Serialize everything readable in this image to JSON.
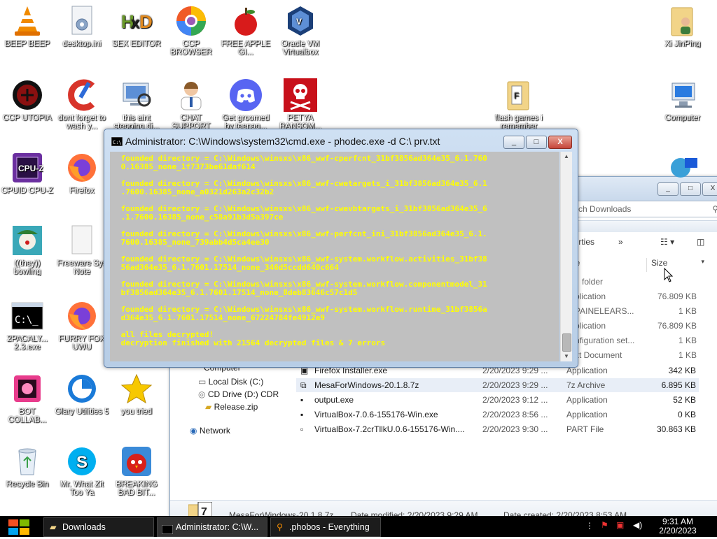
{
  "desktop": {
    "icons": [
      {
        "label": "BEEP BEEP",
        "icon": "vlc-cone-icon"
      },
      {
        "label": "desktop.ini",
        "icon": "settings-file-icon"
      },
      {
        "label": "SEX EDITOR",
        "icon": "hxd-editor-icon"
      },
      {
        "label": "CCP BROWSER",
        "icon": "browser-icon"
      },
      {
        "label": "FREE APPLE GI...",
        "icon": "apple-icon"
      },
      {
        "label": "Oracle VM Virtualbox",
        "icon": "virtualbox-icon"
      },
      {
        "label": "Xi JinPing",
        "icon": "user-folder-icon"
      },
      {
        "label": "CCP UTOPIA",
        "icon": "red-circle-icon"
      },
      {
        "label": "dont forget to wash y...",
        "icon": "ccleaner-icon"
      },
      {
        "label": "this aint stepping di...",
        "icon": "computer-scan-icon"
      },
      {
        "label": "CHAT SUPPORT",
        "icon": "support-person-icon"
      },
      {
        "label": "Get groomed by teenag...",
        "icon": "discord-icon"
      },
      {
        "label": "PETYA RANSOM...",
        "icon": "skull-icon"
      },
      {
        "label": "flash games i remember",
        "icon": "folder-icon"
      },
      {
        "label": "Computer",
        "icon": "computer-icon"
      },
      {
        "label": "CPUID CPU-Z",
        "icon": "cpuz-icon"
      },
      {
        "label": "Firefox",
        "icon": "firefox-icon"
      },
      {
        "label": "((they)) bowling",
        "icon": "clown-icon"
      },
      {
        "label": "Freeware Sys Note",
        "icon": "blank-file-icon"
      },
      {
        "label": "2PACALY... 2.3.exe",
        "icon": "console-app-icon"
      },
      {
        "label": "FURRY FOX UWU",
        "icon": "firefox-icon"
      },
      {
        "label": "BOT COLLAB...",
        "icon": "pink-box-icon"
      },
      {
        "label": "Glary Utilities 5",
        "icon": "glary-icon"
      },
      {
        "label": "you tried",
        "icon": "star-icon"
      },
      {
        "label": "Recycle Bin",
        "icon": "recycle-bin-icon"
      },
      {
        "label": "Mr. What Zit Too Ya",
        "icon": "skype-icon"
      },
      {
        "label": "BREAKING BAD BIT...",
        "icon": "angry-bird-icon"
      }
    ]
  },
  "cmd_window": {
    "title": "Administrator: C:\\Windows\\system32\\cmd.exe - phodec.exe  -d C:\\ prv.txt",
    "minimize": "_",
    "maximize": "□",
    "close": "X",
    "lines": [
      " founded directory = C:\\Windows\\winsxs\\x86_wwf-cperfcnt_31bf3856ad364e35_6.1.760",
      " 0.16385_none_1f7373be61daf614",
      "",
      " founded directory = C:\\Windows\\winsxs\\x86_wwf-cwetargets_i_31bf3856ad364e35_6.1",
      " .7600.16385_none_a0321d263a2c32b2",
      "",
      " founded directory = C:\\Windows\\winsxs\\x86_wwf-cwevbtargets_i_31bf3856ad364e35_6",
      " .1.7600.16385_none_c58a91b3d5a397ce",
      "",
      " founded directory = C:\\Windows\\winsxs\\x86_wwf-perfcnt_ini_31bf3856ad364e35_6.1.",
      " 7600.16385_none_739abb4d5ca4ee30",
      "",
      " founded directory = C:\\Windows\\winsxs\\x86_wwf-system.workflow.activities_31bf38",
      " 56ad364e35_6.1.7601.17514_none_346d5ccdd640c664",
      "",
      " founded directory = C:\\Windows\\winsxs\\x86_wwf-system.workflow.componentmodel_31",
      " bf3856ad364e35_6.1.7601.17514_none_8deb83646c57c1d5",
      "",
      " founded directory = C:\\Windows\\winsxs\\x86_wwf-system.workflow.runtime_31bf3856a",
      " d364e35_6.1.7601.17514_none_67224784fe4912e9",
      "",
      " all files decrypted!",
      " decryption finished with 21564 decrypted files & 7 errors",
      "",
      "_"
    ]
  },
  "explorer": {
    "search_placeholder": "rch Downloads",
    "toolbar_properties": "perties",
    "toolbar_more": "»",
    "col_type": "pe",
    "col_size": "Size",
    "partial_rows": [
      {
        "type": "folder",
        "size": ""
      },
      {
        "type": "plication",
        "size": "76.809 KB"
      },
      {
        "type": "PAINELEARS...",
        "size": "1 KB"
      },
      {
        "type": "plication",
        "size": "76.809 KB"
      },
      {
        "type": "nfiguration set...",
        "size": "1 KB"
      },
      {
        "type": "xt Document",
        "size": "1 KB"
      }
    ],
    "nav": {
      "computer": "Computer",
      "local_disk": "Local Disk (C:)",
      "cd_drive": "CD Drive (D:) CDR",
      "release_zip": "Release.zip",
      "network": "Network"
    },
    "files": [
      {
        "name": "Firefox Installer.exe",
        "date": "2/20/2023 9:29 ...",
        "type": "Application",
        "size": "342 KB"
      },
      {
        "name": "MesaForWindows-20.1.8.7z",
        "date": "2/20/2023 9:29 ...",
        "type": "7z Archive",
        "size": "6.895 KB"
      },
      {
        "name": "output.exe",
        "date": "2/20/2023 9:12 ...",
        "type": "Application",
        "size": "52 KB"
      },
      {
        "name": "VirtualBox-7.0.6-155176-Win.exe",
        "date": "2/20/2023 8:56 ...",
        "type": "Application",
        "size": "0 KB"
      },
      {
        "name": "VirtualBox-7.2crTllkU.0.6-155176-Win....",
        "date": "2/20/2023 9:30 ...",
        "type": "PART File",
        "size": "30.863 KB"
      }
    ],
    "details": {
      "name": "MesaForWindows-20.1.8.7z",
      "modified": "Date modified: 2/20/2023 9:29 AM",
      "created": "Date created: 2/20/2023 8:53 AM"
    }
  },
  "taskbar": {
    "items": [
      {
        "label": "Downloads",
        "icon": "folder-icon"
      },
      {
        "label": "Administrator: C:\\W...",
        "icon": "cmd-icon"
      },
      {
        "label": ".phobos - Everything",
        "icon": "search-icon"
      }
    ],
    "clock_time": "9:31 AM",
    "clock_date": "2/20/2023"
  },
  "colors": {
    "console_bg": "#c0c0c0",
    "console_text": "#ffff00",
    "taskbar_bg": "#000000"
  }
}
